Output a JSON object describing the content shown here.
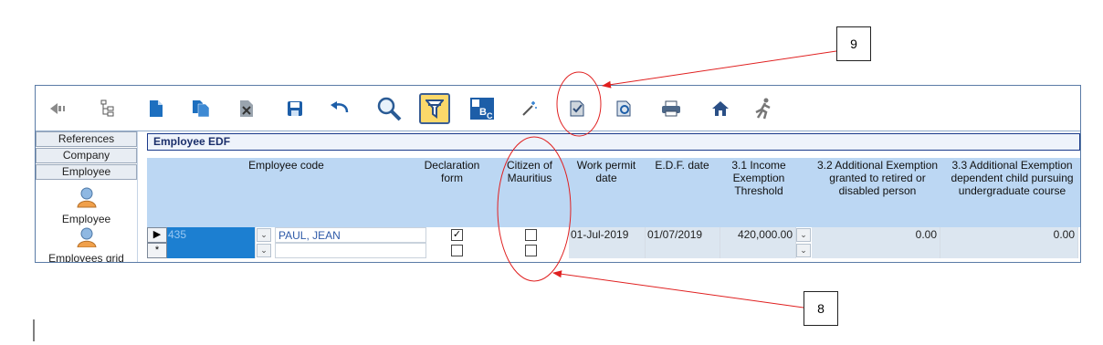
{
  "callouts": {
    "nine": "9",
    "eight": "8"
  },
  "left_nav": {
    "tabs": [
      "References",
      "Company",
      "Employee"
    ],
    "items": [
      "Employee",
      "Employees grid"
    ]
  },
  "panel": {
    "title": "Employee EDF"
  },
  "grid": {
    "headers": {
      "employee_code": "Employee code",
      "declaration_form": "Declaration form",
      "citizen": "Citizen of Mauritius",
      "work_permit": "Work permit date",
      "edf_date": "E.D.F. date",
      "income_threshold": "3.1 Income Exemption Threshold",
      "additional_retired": "3.2 Additional Exemption granted to retired or disabled person",
      "additional_child": "3.3 Additional Exemption dependent child pursuing undergraduate course"
    },
    "rows": [
      {
        "marker": "▶",
        "code": "435",
        "name": "PAUL, JEAN",
        "declaration_checked": true,
        "citizen_checked": false,
        "work_permit": "01-Jul-2019",
        "edf_date": "01/07/2019",
        "income_threshold": "420,000.00",
        "additional_retired": "0.00",
        "additional_child": "0.00"
      },
      {
        "marker": "*",
        "code": "",
        "name": "",
        "declaration_checked": false,
        "citizen_checked": false,
        "work_permit": "",
        "edf_date": "",
        "income_threshold": "",
        "additional_retired": "",
        "additional_child": ""
      }
    ]
  },
  "toolbar_icons": [
    "back-icon",
    "tree-icon",
    "new-document-icon",
    "copy-document-icon",
    "delete-document-icon",
    "save-icon",
    "undo-icon",
    "search-icon",
    "filter-icon",
    "sort-abc-icon",
    "wand-icon",
    "declaration-icon",
    "preview-icon",
    "print-icon",
    "home-icon",
    "exit-runner-icon"
  ],
  "colors": {
    "accent_blue": "#1c7fd1",
    "header_bg": "#bcd7f3",
    "annotation_red": "#e02020"
  }
}
